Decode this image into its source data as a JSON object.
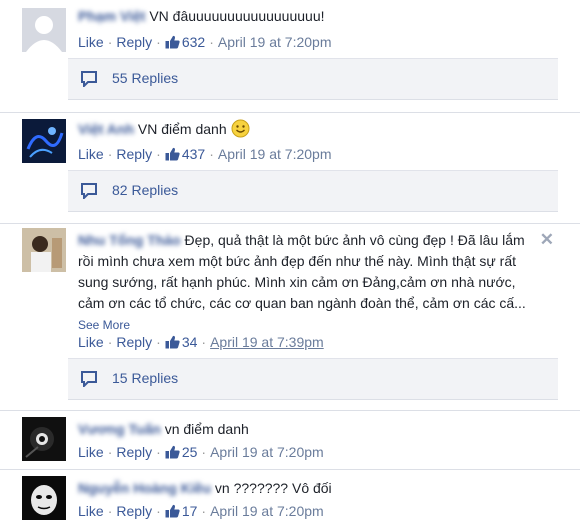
{
  "comments": [
    {
      "author": "Phạm Việt",
      "text": "VN đâuuuuuuuuuuuuuuuuu!",
      "like_label": "Like",
      "reply_label": "Reply",
      "likes": "632",
      "time": "April 19 at 7:20pm",
      "replies": "55 Replies"
    },
    {
      "author": "Việt Anh",
      "text": "VN điểm danh",
      "like_label": "Like",
      "reply_label": "Reply",
      "likes": "437",
      "time": "April 19 at 7:20pm",
      "replies": "82 Replies"
    },
    {
      "author": "Nhu Tổng Thảo",
      "text": "Đẹp, quả thật là một bức ảnh vô cùng đẹp ! Đã lâu lắm rồi mình chưa xem một bức ảnh đẹp đến như thế này. Mình thật sự rất sung sướng, rất hạnh phúc. Mình xin cảm ơn Đảng,cảm ơn nhà nước, cảm ơn các tổ chức, các cơ quan ban ngành đoàn thể, cảm ơn các cấ...",
      "see_more": "See More",
      "like_label": "Like",
      "reply_label": "Reply",
      "likes": "34",
      "time": "April 19 at 7:39pm",
      "replies": "15 Replies"
    },
    {
      "author": "Vương Tuấn",
      "text": "vn điểm danh",
      "like_label": "Like",
      "reply_label": "Reply",
      "likes": "25",
      "time": "April 19 at 7:20pm"
    },
    {
      "author": "Nguyễn Hoàng Kiều",
      "text": "vn ??????? Vô đối",
      "like_label": "Like",
      "reply_label": "Reply",
      "likes": "17",
      "time": "April 19 at 7:20pm"
    }
  ],
  "icons": {
    "like": "thumbs-up-icon",
    "replies": "speech-bubble-icon",
    "close": "close-icon",
    "emoji": "smiley-icon"
  },
  "colors": {
    "link": "#3b5998",
    "muted": "#6a7c9b",
    "reply_bg": "#f2f3f6"
  }
}
